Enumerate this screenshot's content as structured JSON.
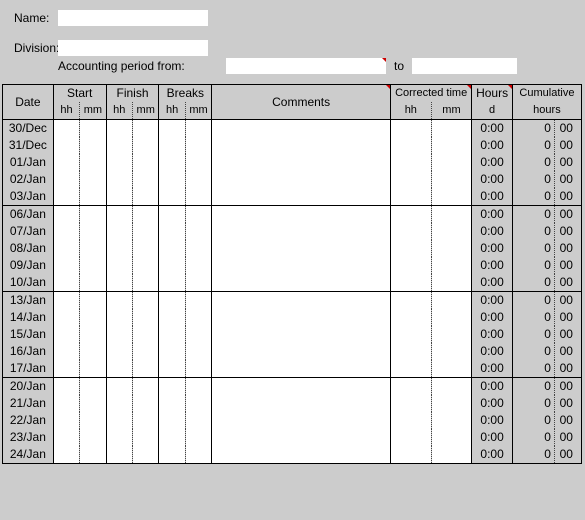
{
  "form": {
    "name_label": "Name:",
    "division_label": "Division:",
    "period_label": "Accounting period from:",
    "to_label": "to",
    "name_value": "",
    "division_value": "",
    "period_from": "",
    "period_to": ""
  },
  "headers": {
    "date": "Date",
    "start": "Start",
    "finish": "Finish",
    "breaks": "Breaks",
    "comments": "Comments",
    "corrected": "Corrected time",
    "hours": "Hours",
    "cumulative": "Cumulative",
    "hh": "hh",
    "mm": "mm",
    "d": "d",
    "cum_sub": "hours"
  },
  "rows": [
    {
      "date": "30/Dec",
      "hours": "0:00",
      "cum_a": "0",
      "cum_b": "00",
      "sep": true
    },
    {
      "date": "31/Dec",
      "hours": "0:00",
      "cum_a": "0",
      "cum_b": "00",
      "sep": false
    },
    {
      "date": "01/Jan",
      "hours": "0:00",
      "cum_a": "0",
      "cum_b": "00",
      "sep": false
    },
    {
      "date": "02/Jan",
      "hours": "0:00",
      "cum_a": "0",
      "cum_b": "00",
      "sep": false
    },
    {
      "date": "03/Jan",
      "hours": "0:00",
      "cum_a": "0",
      "cum_b": "00",
      "sep": false
    },
    {
      "date": "06/Jan",
      "hours": "0:00",
      "cum_a": "0",
      "cum_b": "00",
      "sep": true
    },
    {
      "date": "07/Jan",
      "hours": "0:00",
      "cum_a": "0",
      "cum_b": "00",
      "sep": false
    },
    {
      "date": "08/Jan",
      "hours": "0:00",
      "cum_a": "0",
      "cum_b": "00",
      "sep": false
    },
    {
      "date": "09/Jan",
      "hours": "0:00",
      "cum_a": "0",
      "cum_b": "00",
      "sep": false
    },
    {
      "date": "10/Jan",
      "hours": "0:00",
      "cum_a": "0",
      "cum_b": "00",
      "sep": false
    },
    {
      "date": "13/Jan",
      "hours": "0:00",
      "cum_a": "0",
      "cum_b": "00",
      "sep": true
    },
    {
      "date": "14/Jan",
      "hours": "0:00",
      "cum_a": "0",
      "cum_b": "00",
      "sep": false
    },
    {
      "date": "15/Jan",
      "hours": "0:00",
      "cum_a": "0",
      "cum_b": "00",
      "sep": false
    },
    {
      "date": "16/Jan",
      "hours": "0:00",
      "cum_a": "0",
      "cum_b": "00",
      "sep": false
    },
    {
      "date": "17/Jan",
      "hours": "0:00",
      "cum_a": "0",
      "cum_b": "00",
      "sep": false
    },
    {
      "date": "20/Jan",
      "hours": "0:00",
      "cum_a": "0",
      "cum_b": "00",
      "sep": true
    },
    {
      "date": "21/Jan",
      "hours": "0:00",
      "cum_a": "0",
      "cum_b": "00",
      "sep": false
    },
    {
      "date": "22/Jan",
      "hours": "0:00",
      "cum_a": "0",
      "cum_b": "00",
      "sep": false
    },
    {
      "date": "23/Jan",
      "hours": "0:00",
      "cum_a": "0",
      "cum_b": "00",
      "sep": false
    },
    {
      "date": "24/Jan",
      "hours": "0:00",
      "cum_a": "0",
      "cum_b": "00",
      "sep": false
    }
  ]
}
